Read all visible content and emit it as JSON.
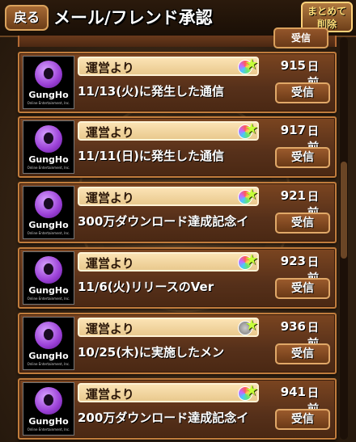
{
  "header": {
    "back_label": "戻る",
    "title": "メール/フレンド承認",
    "bulk_delete_line1": "まとめて",
    "bulk_delete_line2": "削除"
  },
  "partial_row": {
    "receive_label": "受信"
  },
  "mails": [
    {
      "sender": "運営より",
      "avatar_text": "GungHo",
      "avatar_sub": "Online Entertainment, Inc.",
      "gem": "rainbow-gem",
      "days": "915",
      "days_unit": "日前",
      "subject": "11/13(火)に発生した通信",
      "receive_label": "受信"
    },
    {
      "sender": "運営より",
      "avatar_text": "GungHo",
      "avatar_sub": "Online Entertainment, Inc.",
      "gem": "rainbow-gem",
      "days": "917",
      "days_unit": "日前",
      "subject": "11/11(日)に発生した通信",
      "receive_label": "受信"
    },
    {
      "sender": "運営より",
      "avatar_text": "GungHo",
      "avatar_sub": "Online Entertainment, Inc.",
      "gem": "rainbow-gem",
      "days": "921",
      "days_unit": "日前",
      "subject": "300万ダウンロード達成記念イ",
      "receive_label": "受信"
    },
    {
      "sender": "運営より",
      "avatar_text": "GungHo",
      "avatar_sub": "Online Entertainment, Inc.",
      "gem": "rainbow-gem",
      "days": "923",
      "days_unit": "日前",
      "subject": "11/6(火)リリースのVer",
      "receive_label": "受信"
    },
    {
      "sender": "運営より",
      "avatar_text": "GungHo",
      "avatar_sub": "Online Entertainment, Inc.",
      "gem": "grey-coin",
      "days": "936",
      "days_unit": "日前",
      "subject": "10/25(木)に実施したメン",
      "receive_label": "受信"
    },
    {
      "sender": "運営より",
      "avatar_text": "GungHo",
      "avatar_sub": "Online Entertainment, Inc.",
      "gem": "rainbow-gem",
      "days": "941",
      "days_unit": "日前",
      "subject": "200万ダウンロード達成記念イ",
      "receive_label": "受信"
    }
  ],
  "colors": {
    "accent_star": "#c6ff3a",
    "row_border": "#c07c3c",
    "sender_box": "#fbe3b4"
  }
}
